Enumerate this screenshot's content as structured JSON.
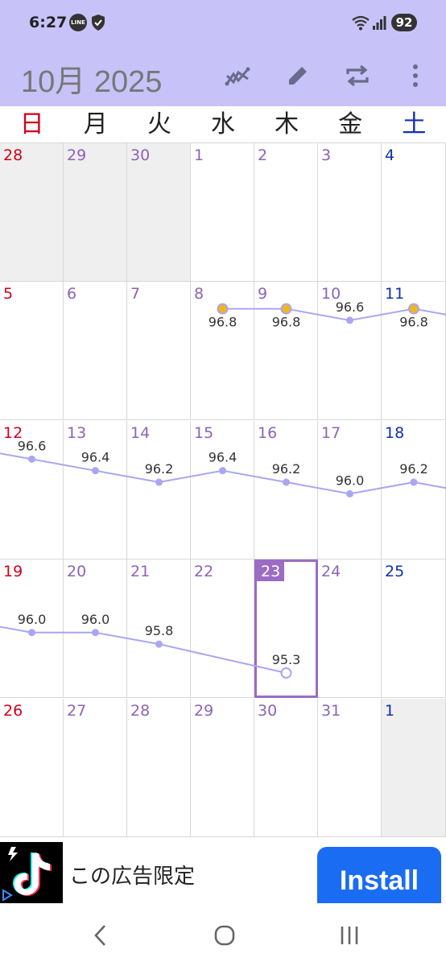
{
  "status": {
    "time": "6:27",
    "line_badge": "LINE",
    "battery": "92"
  },
  "appbar": {
    "title": "10月 2025",
    "icons": [
      "chart-icon",
      "edit-icon",
      "repeat-icon",
      "more-icon"
    ]
  },
  "weekdays": [
    "日",
    "月",
    "火",
    "水",
    "木",
    "金",
    "土"
  ],
  "colors": {
    "sunday": "#d0021b",
    "saturday": "#1030b0",
    "weekday": "#8e63b5",
    "accent": "#9b6cc4",
    "line": "#a9a6f2",
    "highlight_point": "#f2b51b",
    "appbar": "#c7c3f8"
  },
  "calendar": {
    "today": "23",
    "weeks": [
      [
        {
          "day": "28",
          "out": true
        },
        {
          "day": "29",
          "out": true
        },
        {
          "day": "30",
          "out": true
        },
        {
          "day": "1"
        },
        {
          "day": "2"
        },
        {
          "day": "3"
        },
        {
          "day": "4"
        }
      ],
      [
        {
          "day": "5"
        },
        {
          "day": "6"
        },
        {
          "day": "7"
        },
        {
          "day": "8",
          "value": "96.8",
          "highlight": true
        },
        {
          "day": "9",
          "value": "96.8",
          "highlight": true
        },
        {
          "day": "10",
          "value": "96.6"
        },
        {
          "day": "11",
          "value": "96.8",
          "highlight": true
        }
      ],
      [
        {
          "day": "12",
          "value": "96.6"
        },
        {
          "day": "13",
          "value": "96.4"
        },
        {
          "day": "14",
          "value": "96.2"
        },
        {
          "day": "15",
          "value": "96.4"
        },
        {
          "day": "16",
          "value": "96.2"
        },
        {
          "day": "17",
          "value": "96.0"
        },
        {
          "day": "18",
          "value": "96.2"
        }
      ],
      [
        {
          "day": "19",
          "value": "96.0"
        },
        {
          "day": "20",
          "value": "96.0"
        },
        {
          "day": "21",
          "value": "95.8"
        },
        {
          "day": "22"
        },
        {
          "day": "23",
          "value": "95.3",
          "today": true,
          "hollow": true
        },
        {
          "day": "24"
        },
        {
          "day": "25"
        }
      ],
      [
        {
          "day": "26"
        },
        {
          "day": "27"
        },
        {
          "day": "28"
        },
        {
          "day": "29"
        },
        {
          "day": "30"
        },
        {
          "day": "31"
        },
        {
          "day": "1",
          "out": true
        }
      ]
    ]
  },
  "ad": {
    "text": "この広告限定",
    "install_label": "Install"
  },
  "navbar": {
    "icons": [
      "back-icon",
      "home-icon",
      "recents-icon"
    ]
  }
}
